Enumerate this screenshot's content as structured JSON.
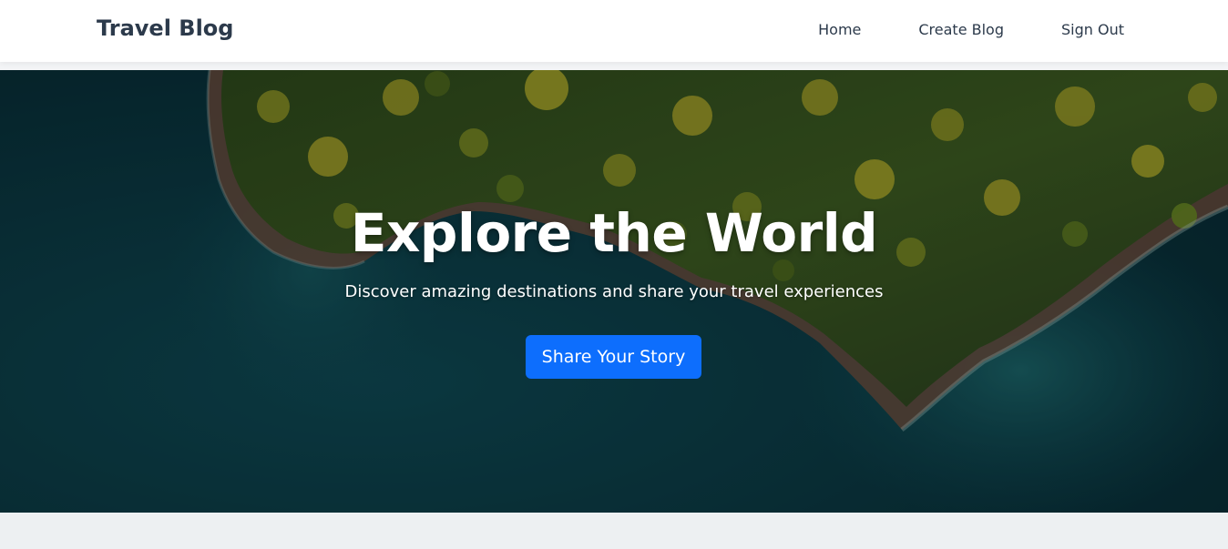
{
  "navbar": {
    "brand": "Travel Blog",
    "links": [
      {
        "label": "Home"
      },
      {
        "label": "Create Blog"
      },
      {
        "label": "Sign Out"
      }
    ]
  },
  "hero": {
    "title": "Explore the World",
    "subtitle": "Discover amazing destinations and share your travel experiences",
    "cta_label": "Share Your Story",
    "background_image": "aerial-island-coastline",
    "colors": {
      "sea": "#0c3a45",
      "forest": "#3b5a20",
      "foliage_highlight": "#a8a62a",
      "button": "#0d6efd"
    }
  }
}
